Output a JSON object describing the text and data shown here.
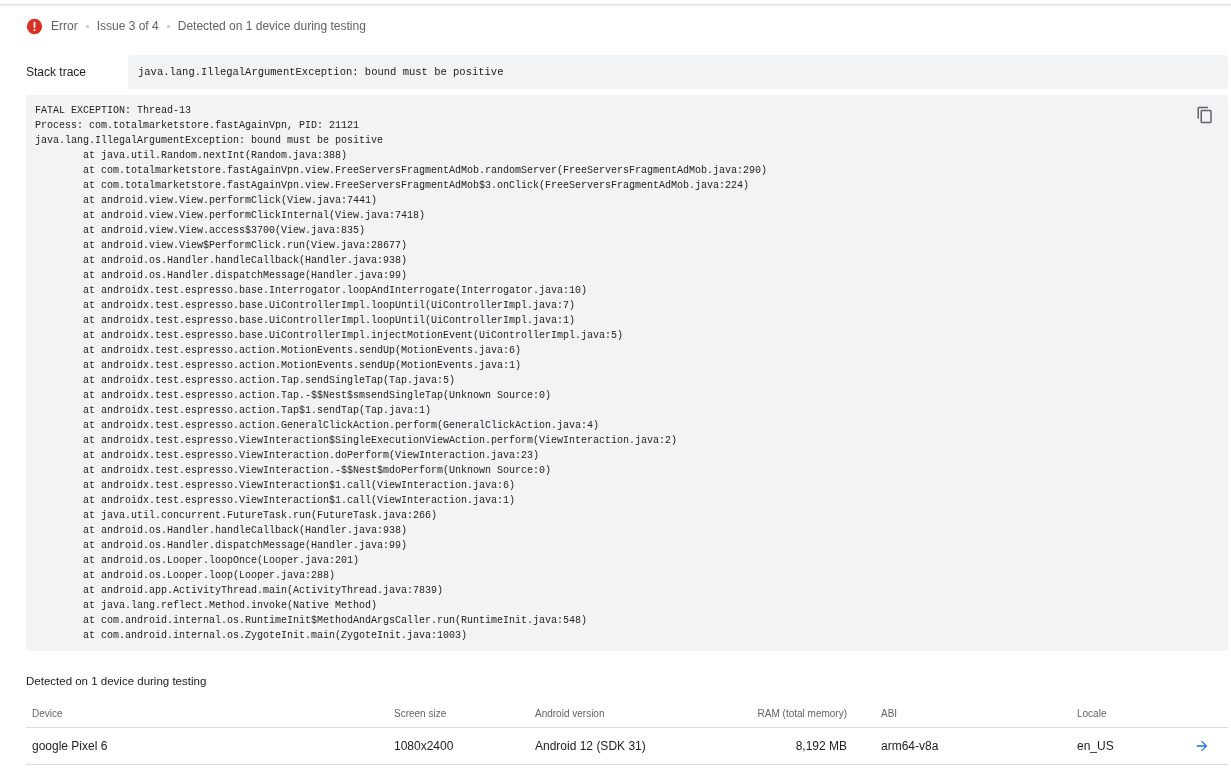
{
  "issue": {
    "kind": "error",
    "severity_label": "Error",
    "position": "Issue 3 of 4",
    "detection": "Detected on 1 device during testing"
  },
  "stack_trace": {
    "label": "Stack trace",
    "summary": "java.lang.IllegalArgumentException: bound must be positive",
    "lines": [
      {
        "kind": "header",
        "text": "FATAL EXCEPTION: Thread-13"
      },
      {
        "kind": "header",
        "text": "Process: com.totalmarketstore.fastAgainVpn, PID: 21121"
      },
      {
        "kind": "header",
        "text": "java.lang.IllegalArgumentException: bound must be positive"
      },
      {
        "kind": "frame",
        "text": "at java.util.Random.nextInt(Random.java:388)"
      },
      {
        "kind": "frame",
        "text": "at com.totalmarketstore.fastAgainVpn.view.FreeServersFragmentAdMob.randomServer(FreeServersFragmentAdMob.java:290)"
      },
      {
        "kind": "frame",
        "text": "at com.totalmarketstore.fastAgainVpn.view.FreeServersFragmentAdMob$3.onClick(FreeServersFragmentAdMob.java:224)"
      },
      {
        "kind": "frame",
        "text": "at android.view.View.performClick(View.java:7441)"
      },
      {
        "kind": "frame",
        "text": "at android.view.View.performClickInternal(View.java:7418)"
      },
      {
        "kind": "frame",
        "text": "at android.view.View.access$3700(View.java:835)"
      },
      {
        "kind": "frame",
        "text": "at android.view.View$PerformClick.run(View.java:28677)"
      },
      {
        "kind": "frame",
        "text": "at android.os.Handler.handleCallback(Handler.java:938)"
      },
      {
        "kind": "frame",
        "text": "at android.os.Handler.dispatchMessage(Handler.java:99)"
      },
      {
        "kind": "frame",
        "text": "at androidx.test.espresso.base.Interrogator.loopAndInterrogate(Interrogator.java:10)"
      },
      {
        "kind": "frame",
        "text": "at androidx.test.espresso.base.UiControllerImpl.loopUntil(UiControllerImpl.java:7)"
      },
      {
        "kind": "frame",
        "text": "at androidx.test.espresso.base.UiControllerImpl.loopUntil(UiControllerImpl.java:1)"
      },
      {
        "kind": "frame",
        "text": "at androidx.test.espresso.base.UiControllerImpl.injectMotionEvent(UiControllerImpl.java:5)"
      },
      {
        "kind": "frame",
        "text": "at androidx.test.espresso.action.MotionEvents.sendUp(MotionEvents.java:6)"
      },
      {
        "kind": "frame",
        "text": "at androidx.test.espresso.action.MotionEvents.sendUp(MotionEvents.java:1)"
      },
      {
        "kind": "frame",
        "text": "at androidx.test.espresso.action.Tap.sendSingleTap(Tap.java:5)"
      },
      {
        "kind": "frame",
        "text": "at androidx.test.espresso.action.Tap.-$$Nest$smsendSingleTap(Unknown Source:0)"
      },
      {
        "kind": "frame",
        "text": "at androidx.test.espresso.action.Tap$1.sendTap(Tap.java:1)"
      },
      {
        "kind": "frame",
        "text": "at androidx.test.espresso.action.GeneralClickAction.perform(GeneralClickAction.java:4)"
      },
      {
        "kind": "frame",
        "text": "at androidx.test.espresso.ViewInteraction$SingleExecutionViewAction.perform(ViewInteraction.java:2)"
      },
      {
        "kind": "frame",
        "text": "at androidx.test.espresso.ViewInteraction.doPerform(ViewInteraction.java:23)"
      },
      {
        "kind": "frame",
        "text": "at androidx.test.espresso.ViewInteraction.-$$Nest$mdoPerform(Unknown Source:0)"
      },
      {
        "kind": "frame",
        "text": "at androidx.test.espresso.ViewInteraction$1.call(ViewInteraction.java:6)"
      },
      {
        "kind": "frame",
        "text": "at androidx.test.espresso.ViewInteraction$1.call(ViewInteraction.java:1)"
      },
      {
        "kind": "frame",
        "text": "at java.util.concurrent.FutureTask.run(FutureTask.java:266)"
      },
      {
        "kind": "frame",
        "text": "at android.os.Handler.handleCallback(Handler.java:938)"
      },
      {
        "kind": "frame",
        "text": "at android.os.Handler.dispatchMessage(Handler.java:99)"
      },
      {
        "kind": "frame",
        "text": "at android.os.Looper.loopOnce(Looper.java:201)"
      },
      {
        "kind": "frame",
        "text": "at android.os.Looper.loop(Looper.java:288)"
      },
      {
        "kind": "frame",
        "text": "at android.app.ActivityThread.main(ActivityThread.java:7839)"
      },
      {
        "kind": "frame",
        "text": "at java.lang.reflect.Method.invoke(Native Method)"
      },
      {
        "kind": "frame",
        "text": "at com.android.internal.os.RuntimeInit$MethodAndArgsCaller.run(RuntimeInit.java:548)"
      },
      {
        "kind": "frame",
        "text": "at com.android.internal.os.ZygoteInit.main(ZygoteInit.java:1003)"
      }
    ]
  },
  "devices": {
    "title": "Detected on 1 device during testing",
    "columns": [
      "Device",
      "Screen size",
      "Android version",
      "RAM (total memory)",
      "ABI",
      "Locale"
    ],
    "rows": [
      {
        "cells": [
          "google Pixel 6",
          "1080x2400",
          "Android 12 (SDK 31)",
          "8,192 MB",
          "arm64-v8a",
          "en_US"
        ]
      }
    ]
  }
}
